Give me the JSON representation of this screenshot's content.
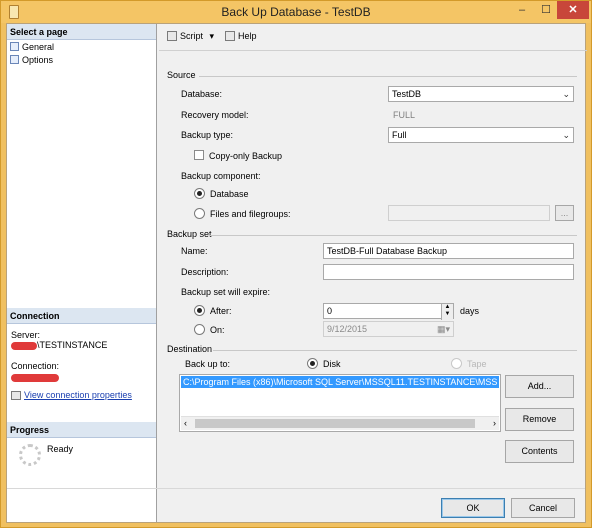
{
  "window": {
    "title": "Back Up Database - TestDB",
    "min": "–",
    "max": "☐",
    "close": "✕"
  },
  "left": {
    "select_page": "Select a page",
    "pages": [
      {
        "label": "General"
      },
      {
        "label": "Options"
      }
    ],
    "connection_header": "Connection",
    "server_label": "Server:",
    "server_value": "\\TESTINSTANCE",
    "connection_label": "Connection:",
    "view_conn": "View connection properties",
    "progress_header": "Progress",
    "progress_status": "Ready"
  },
  "toolbar": {
    "script": "Script",
    "help": "Help"
  },
  "source": {
    "title": "Source",
    "database_label": "Database:",
    "database_value": "TestDB",
    "recovery_label": "Recovery model:",
    "recovery_value": "FULL",
    "backup_type_label": "Backup type:",
    "backup_type_value": "Full",
    "copy_only": "Copy-only Backup",
    "component_label": "Backup component:",
    "opt_database": "Database",
    "opt_files": "Files and filegroups:",
    "files_button": "..."
  },
  "backupset": {
    "title": "Backup set",
    "name_label": "Name:",
    "name_value": "TestDB-Full Database Backup",
    "desc_label": "Description:",
    "desc_value": "",
    "expire_label": "Backup set will expire:",
    "after_label": "After:",
    "after_value": "0",
    "days": "days",
    "on_label": "On:",
    "on_value": "9/12/2015"
  },
  "destination": {
    "title": "Destination",
    "backup_to": "Back up to:",
    "disk": "Disk",
    "tape": "Tape",
    "path": "C:\\Program Files (x86)\\Microsoft SQL Server\\MSSQL11.TESTINSTANCE\\MSS",
    "add": "Add...",
    "remove": "Remove",
    "contents": "Contents"
  },
  "footer": {
    "ok": "OK",
    "cancel": "Cancel"
  }
}
